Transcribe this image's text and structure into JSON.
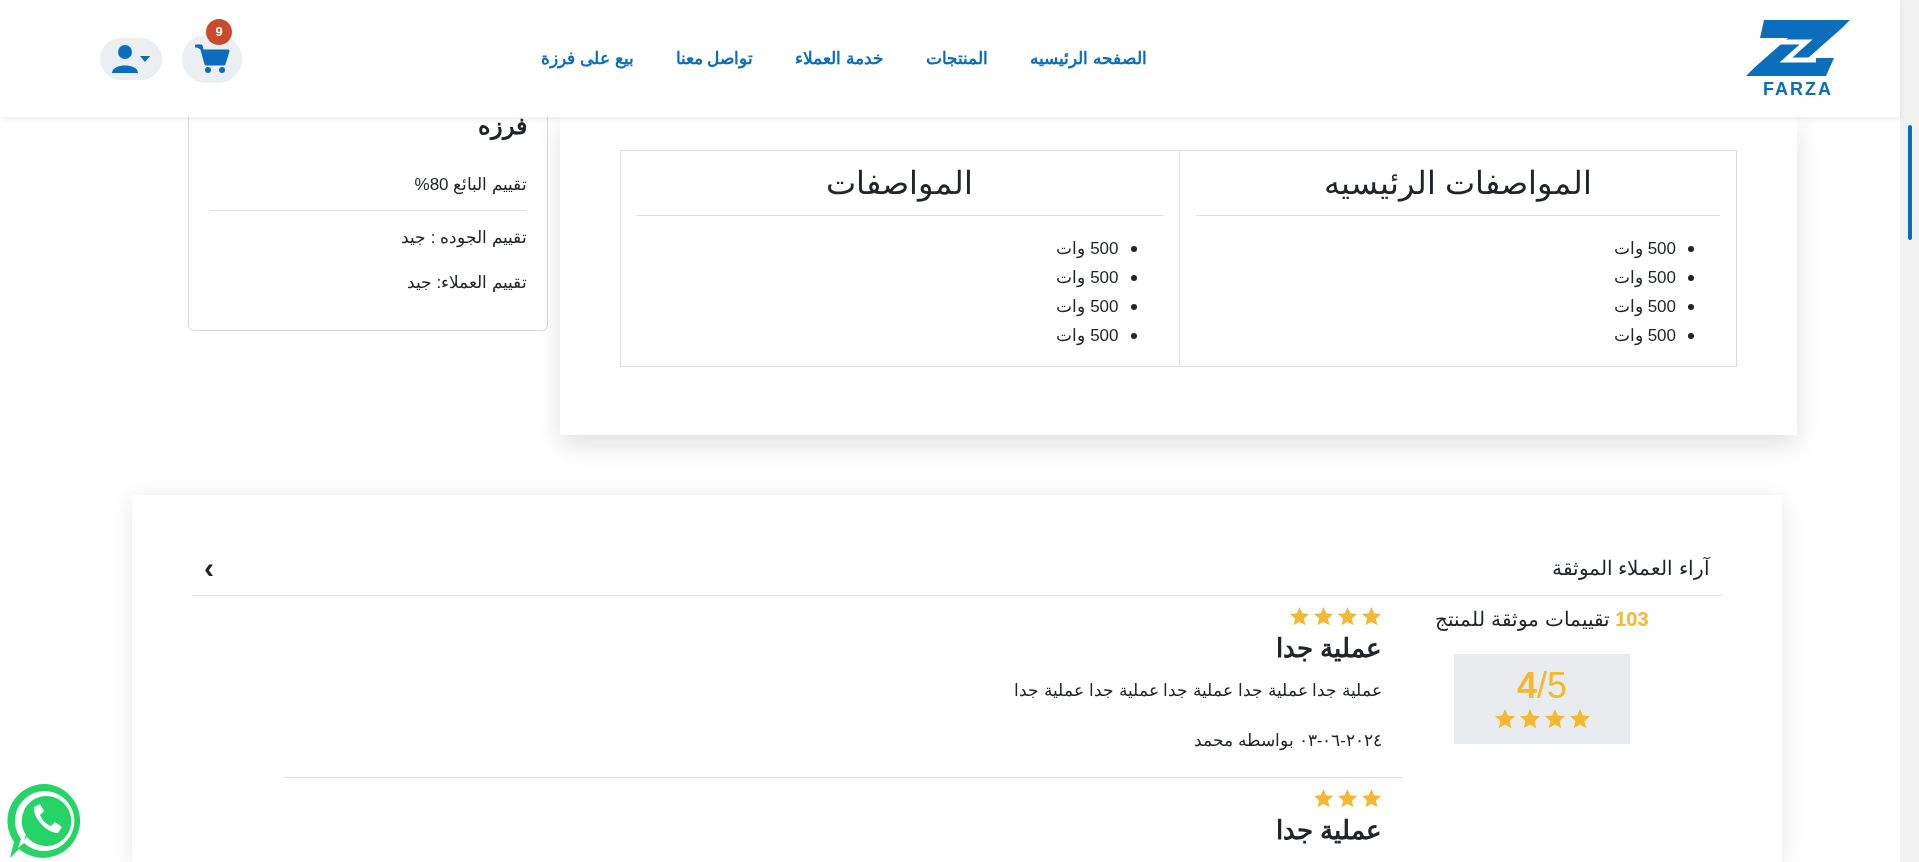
{
  "header": {
    "logo_text": "FARZA",
    "nav": [
      "الصفحه الرئيسيه",
      "المنتجات",
      "خدمة العملاء",
      "تواصل معنا",
      "بيع على فرزة"
    ],
    "cart_count": "9"
  },
  "seller_card": {
    "title": "فرزه",
    "lines": [
      "تقييم البائع 80%",
      "تقييم الجوده : جيد",
      "تقييم العملاء: جيد"
    ]
  },
  "specs": {
    "columns": [
      {
        "title": "المواصفات الرئيسيه",
        "items": [
          "500 وات",
          "500 وات",
          "500 وات",
          "500 وات"
        ]
      },
      {
        "title": "المواصفات",
        "items": [
          "500 وات",
          "500 وات",
          "500 وات",
          "500 وات"
        ]
      }
    ]
  },
  "reviews": {
    "title": "آراء العملاء الموثقة",
    "next": "›",
    "count": "103",
    "count_label": "تقييمات موثقة للمنتج",
    "score": "4",
    "score_max": "/5",
    "stars": 4,
    "items": [
      {
        "stars": 4,
        "title": "عملية جدا",
        "text": "عملية جدا عملية جدا عملية جدا عملية جدا عملية جدا",
        "meta": "٢٠٢٤-٠٦-٠٣ بواسطه محمد"
      },
      {
        "stars": 3,
        "title": "عملية جدا"
      }
    ]
  }
}
